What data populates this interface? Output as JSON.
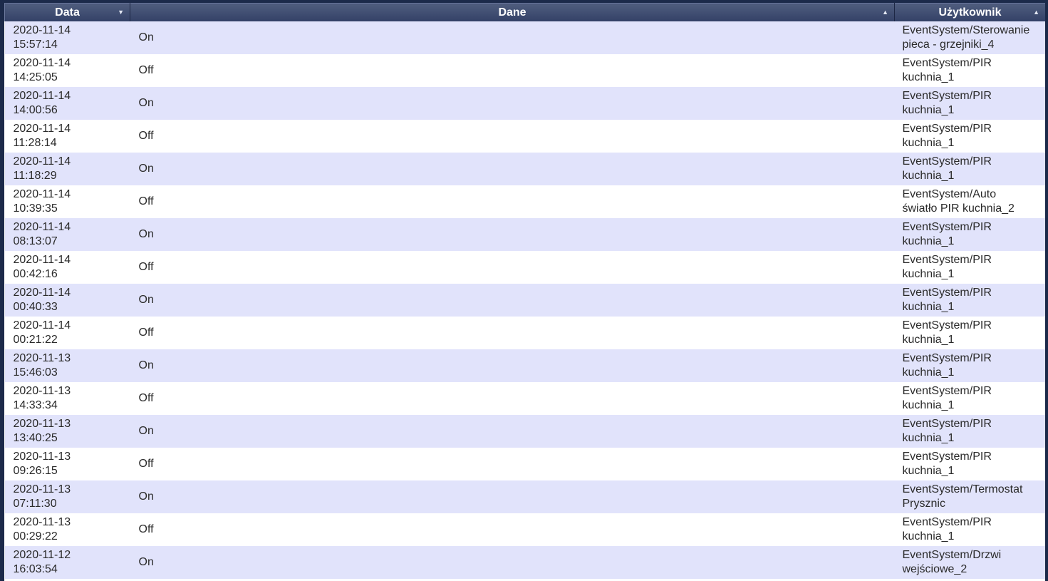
{
  "columns": {
    "date": "Data",
    "data": "Dane",
    "user": "Użytkownik"
  },
  "sort_indicators": {
    "date": "▼",
    "data": "▲",
    "user": "▲"
  },
  "rows": [
    {
      "date": "2020-11-14",
      "time": "15:57:14",
      "value": "On",
      "user_line1": "EventSystem/Sterowanie",
      "user_line2": "pieca - grzejniki_4"
    },
    {
      "date": "2020-11-14",
      "time": "14:25:05",
      "value": "Off",
      "user_line1": "EventSystem/PIR",
      "user_line2": "kuchnia_1"
    },
    {
      "date": "2020-11-14",
      "time": "14:00:56",
      "value": "On",
      "user_line1": "EventSystem/PIR",
      "user_line2": "kuchnia_1"
    },
    {
      "date": "2020-11-14",
      "time": "11:28:14",
      "value": "Off",
      "user_line1": "EventSystem/PIR",
      "user_line2": "kuchnia_1"
    },
    {
      "date": "2020-11-14",
      "time": "11:18:29",
      "value": "On",
      "user_line1": "EventSystem/PIR",
      "user_line2": "kuchnia_1"
    },
    {
      "date": "2020-11-14",
      "time": "10:39:35",
      "value": "Off",
      "user_line1": "EventSystem/Auto",
      "user_line2": "światło PIR kuchnia_2"
    },
    {
      "date": "2020-11-14",
      "time": "08:13:07",
      "value": "On",
      "user_line1": "EventSystem/PIR",
      "user_line2": "kuchnia_1"
    },
    {
      "date": "2020-11-14",
      "time": "00:42:16",
      "value": "Off",
      "user_line1": "EventSystem/PIR",
      "user_line2": "kuchnia_1"
    },
    {
      "date": "2020-11-14",
      "time": "00:40:33",
      "value": "On",
      "user_line1": "EventSystem/PIR",
      "user_line2": "kuchnia_1"
    },
    {
      "date": "2020-11-14",
      "time": "00:21:22",
      "value": "Off",
      "user_line1": "EventSystem/PIR",
      "user_line2": "kuchnia_1"
    },
    {
      "date": "2020-11-13",
      "time": "15:46:03",
      "value": "On",
      "user_line1": "EventSystem/PIR",
      "user_line2": "kuchnia_1"
    },
    {
      "date": "2020-11-13",
      "time": "14:33:34",
      "value": "Off",
      "user_line1": "EventSystem/PIR",
      "user_line2": "kuchnia_1"
    },
    {
      "date": "2020-11-13",
      "time": "13:40:25",
      "value": "On",
      "user_line1": "EventSystem/PIR",
      "user_line2": "kuchnia_1"
    },
    {
      "date": "2020-11-13",
      "time": "09:26:15",
      "value": "Off",
      "user_line1": "EventSystem/PIR",
      "user_line2": "kuchnia_1"
    },
    {
      "date": "2020-11-13",
      "time": "07:11:30",
      "value": "On",
      "user_line1": "EventSystem/Termostat",
      "user_line2": "Prysznic"
    },
    {
      "date": "2020-11-13",
      "time": "00:29:22",
      "value": "Off",
      "user_line1": "EventSystem/PIR",
      "user_line2": "kuchnia_1"
    },
    {
      "date": "2020-11-12",
      "time": "16:03:54",
      "value": "On",
      "user_line1": "EventSystem/Drzwi",
      "user_line2": "wejściowe_2"
    }
  ]
}
